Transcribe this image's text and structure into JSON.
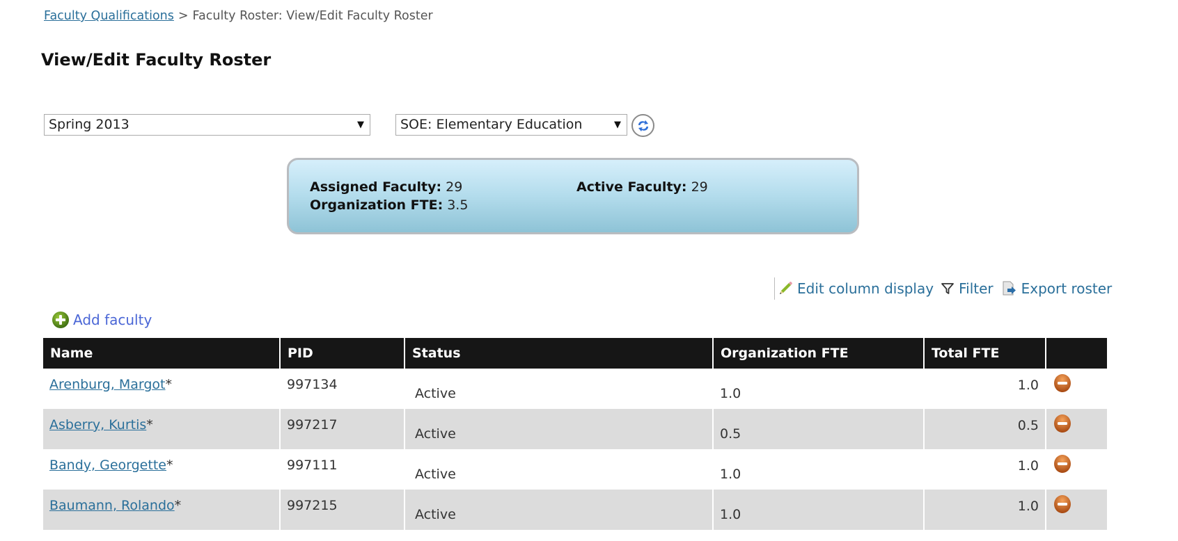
{
  "breadcrumb": {
    "parent_link": "Faculty Qualifications",
    "separator": ">",
    "current": "Faculty Roster: View/Edit Faculty Roster"
  },
  "page_title": "View/Edit Faculty Roster",
  "filters": {
    "term_select": {
      "selected": "Spring 2013",
      "caret": "▼"
    },
    "org_select": {
      "selected": "SOE: Elementary Education",
      "caret": "▼"
    },
    "refresh_icon": "refresh-icon"
  },
  "stats": {
    "assigned_label": "Assigned Faculty:",
    "assigned_value": "29",
    "active_label": "Active Faculty:",
    "active_value": "29",
    "org_fte_label": "Organization FTE:",
    "org_fte_value": "3.5"
  },
  "toolbar": {
    "edit_columns": "Edit column display",
    "filter": "Filter",
    "export": "Export roster"
  },
  "add_faculty": "Add faculty",
  "table": {
    "columns": [
      "Name",
      "PID",
      "Status",
      "Organization FTE",
      "Total FTE",
      ""
    ],
    "rows": [
      {
        "name": "Arenburg, Margot",
        "marker": "*",
        "pid": "997134",
        "status": "Active",
        "org_fte": "1.0",
        "total_fte": "1.0"
      },
      {
        "name": "Asberry, Kurtis",
        "marker": "*",
        "pid": "997217",
        "status": "Active",
        "org_fte": "0.5",
        "total_fte": "0.5"
      },
      {
        "name": "Bandy, Georgette",
        "marker": "*",
        "pid": "997111",
        "status": "Active",
        "org_fte": "1.0",
        "total_fte": "1.0"
      },
      {
        "name": "Baumann, Rolando",
        "marker": "*",
        "pid": "997215",
        "status": "Active",
        "org_fte": "1.0",
        "total_fte": "1.0"
      }
    ]
  },
  "colors": {
    "link": "#2a6f9a",
    "add_link": "#4a66d6",
    "table_header_bg": "#161616",
    "alt_row_bg": "#dcdcdc",
    "remove_icon": "#c8601c",
    "add_icon": "#5a8f1c"
  }
}
